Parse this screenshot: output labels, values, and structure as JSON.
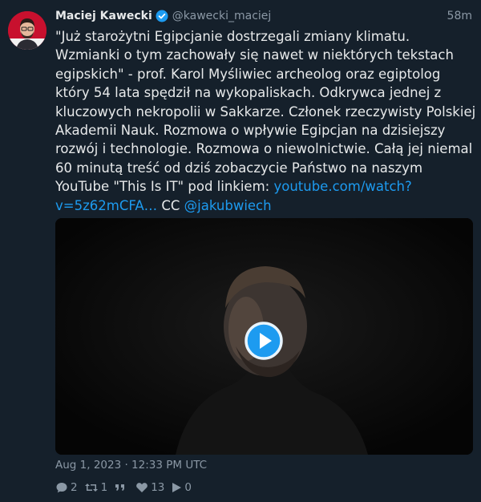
{
  "author": {
    "name": "Maciej Kawecki",
    "handle": "@kawecki_maciej",
    "verified": true
  },
  "time_ago": "58m",
  "tweet": {
    "text": "\"Już starożytni Egipcjanie dostrzegali zmiany klimatu. Wzmianki o tym zachowały się nawet w niektórych tekstach egipskich\" - prof. Karol Myśliwiec archeolog oraz egiptolog który 54 lata spędził na wykopaliskach. Odkrywca jednej z kluczowych nekropolii w Sakkarze. Członek rzeczywisty Polskiej Akademii Nauk. Rozmowa o wpływie Egipcjan na dzisiejszy rozwój i technologie. Rozmowa o niewolnictwie. Całą jej niemal 60 minutą treść od dziś zobaczycie Państwo na naszym YouTube \"This Is IT\" pod linkiem: ",
    "link_text": "youtube.com/watch?v=5z62mCFA…",
    "cc_text": " CC ",
    "mention": "@jakubwiech"
  },
  "media": {
    "type": "video",
    "play_icon": "play-button-icon"
  },
  "date": "Aug 1, 2023 · 12:33 PM UTC",
  "stats": {
    "replies": "2",
    "retweets": "1",
    "likes": "13",
    "views": "0"
  },
  "colors": {
    "background": "#15202b",
    "link": "#1d9bf0",
    "muted": "#8b98a5",
    "verified": "#1d9bf0"
  }
}
